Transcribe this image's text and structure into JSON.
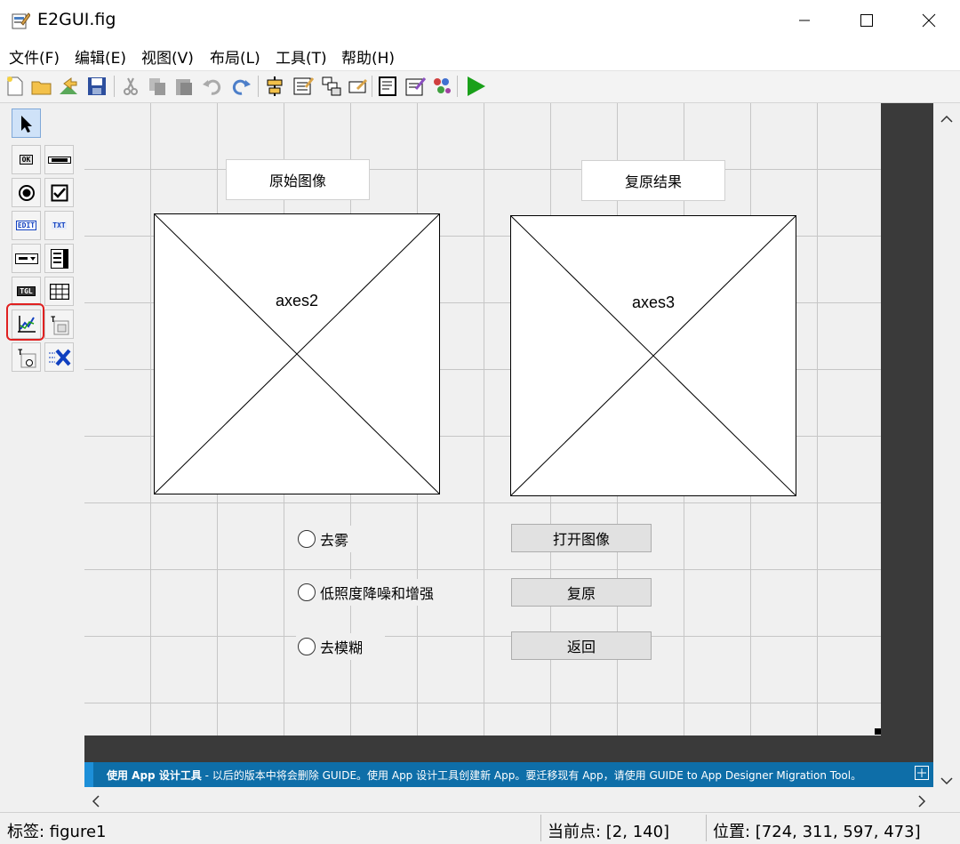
{
  "window": {
    "title": "E2GUI.fig"
  },
  "menu": [
    "文件(F)",
    "编辑(E)",
    "视图(V)",
    "布局(L)",
    "工具(T)",
    "帮助(H)"
  ],
  "palette": {
    "ok_label": "OK",
    "edit_label": "EDIT",
    "txt_label": "TXT",
    "tgl_label": "TGL"
  },
  "canvas": {
    "label_left": "原始图像",
    "label_right": "复原结果",
    "axes_left": "axes2",
    "axes_right": "axes3",
    "radios": [
      "去雾",
      "低照度降噪和增强",
      "去模糊"
    ],
    "buttons": [
      "打开图像",
      "复原",
      "返回"
    ]
  },
  "banner": {
    "bold": "使用 App 设计工具",
    "text": " - 以后的版本中将会删除 GUIDE。使用 App 设计工具创建新 App。要迁移现有 App，请使用 GUIDE to App Designer Migration Tool。"
  },
  "status": {
    "tag": "标签: figure1",
    "current_point": "当前点:  [2, 140]",
    "position": "位置: [724, 311, 597, 473]"
  },
  "colors": {
    "banner": "#0e6ea8",
    "dark_area": "#3a3a3a",
    "highlight": "#e02020",
    "run": "#1aa01a"
  }
}
